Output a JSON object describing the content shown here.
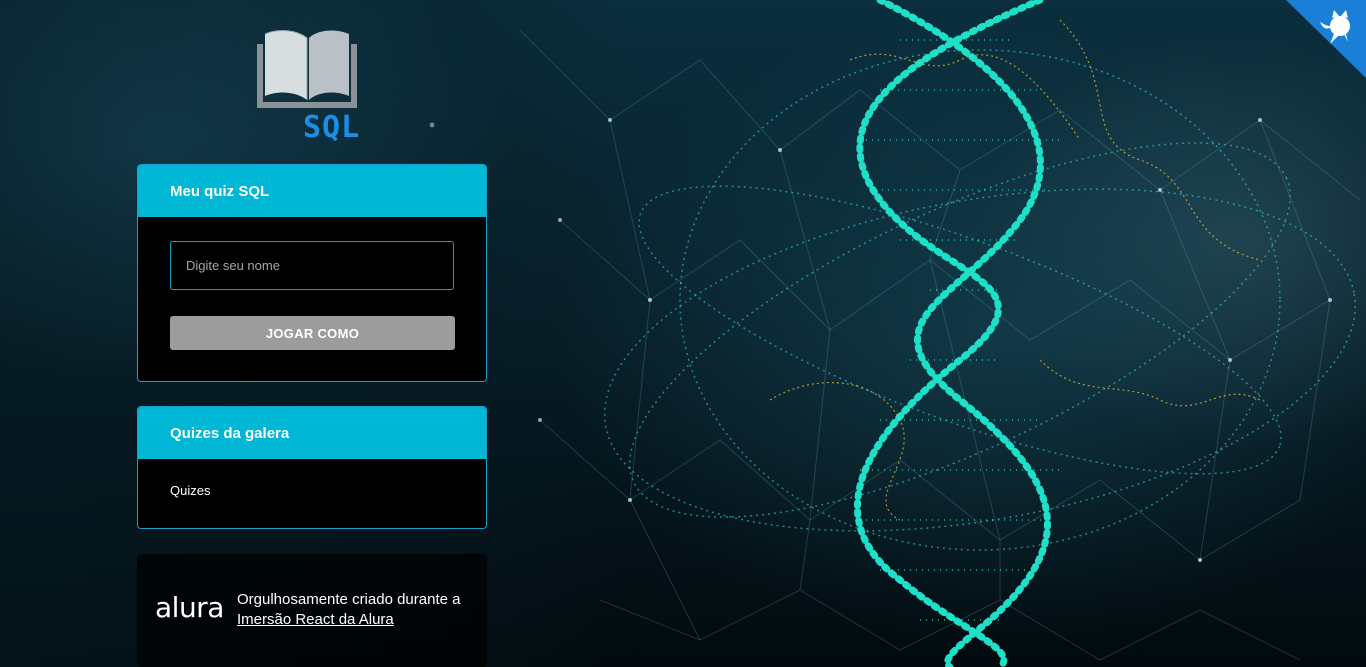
{
  "logo": {
    "text": "SQL"
  },
  "quiz_widget": {
    "title": "Meu quiz SQL",
    "input_placeholder": "Digite seu nome",
    "input_value": "",
    "button_label": "JOGAR COMO"
  },
  "community_widget": {
    "title": "Quizes da galera",
    "text": "Quizes"
  },
  "footer": {
    "brand": "alura",
    "text_prefix": "Orgulhosamente criado durante a",
    "link_text": "Imersão React da Alura"
  },
  "colors": {
    "accent": "#00b7d6",
    "border": "#1b9ec9",
    "button": "#9c9c9c",
    "logo_blue": "#1a8fe3",
    "corner_badge": "#1a7fd6"
  },
  "icons": {
    "logo": "book-icon",
    "corner": "github-octocat-icon"
  }
}
